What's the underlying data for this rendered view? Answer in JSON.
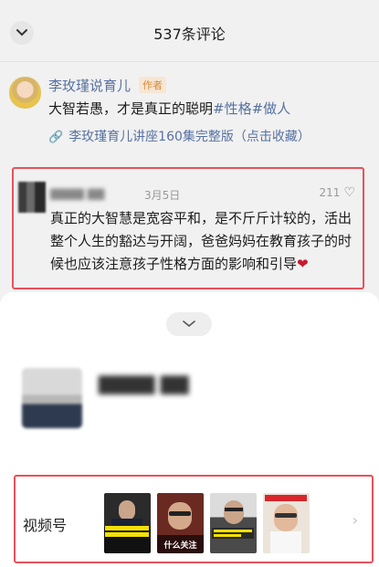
{
  "header": {
    "title": "537条评论"
  },
  "post": {
    "author": "李玫瑾说育儿",
    "author_tag": "作者",
    "text_main": "大智若愚，才是真正的聪明",
    "hashtags": [
      "#性格",
      "#做人"
    ],
    "link_text": "李玫瑾育儿讲座160集完整版（点击收藏）"
  },
  "comment": {
    "user": "▇▇▇▇ ▇▇",
    "date": "3月5日",
    "likes": "211",
    "text": "真正的大智慧是宽容平和，是不斤斤计较的，活出整个人生的豁达与开阔，爸爸妈妈在教育孩子的时候也应该注意孩子性格方面的影响和引导",
    "emoji": "❤"
  },
  "sheet": {
    "profile_name": "▇▇▇▇ ▇▇",
    "channels_label": "视频号",
    "thumbnails": [
      {
        "caption_top": "",
        "caption_bottom": "",
        "bg": "#1e1e1e",
        "accent": "#f3e000"
      },
      {
        "caption_top": "",
        "caption_bottom": "什么关注",
        "bg": "#5a1e1e",
        "accent": "#ffffff"
      },
      {
        "caption_top": "",
        "caption_bottom": "",
        "bg": "#3a3a3a",
        "accent": "#f3e000"
      },
      {
        "caption_top": "",
        "caption_bottom": "",
        "bg": "#e9e0d6",
        "accent": "#d8262c"
      }
    ]
  },
  "colors": {
    "accent_blue": "#5771a3",
    "highlight_red": "#e8515b"
  }
}
